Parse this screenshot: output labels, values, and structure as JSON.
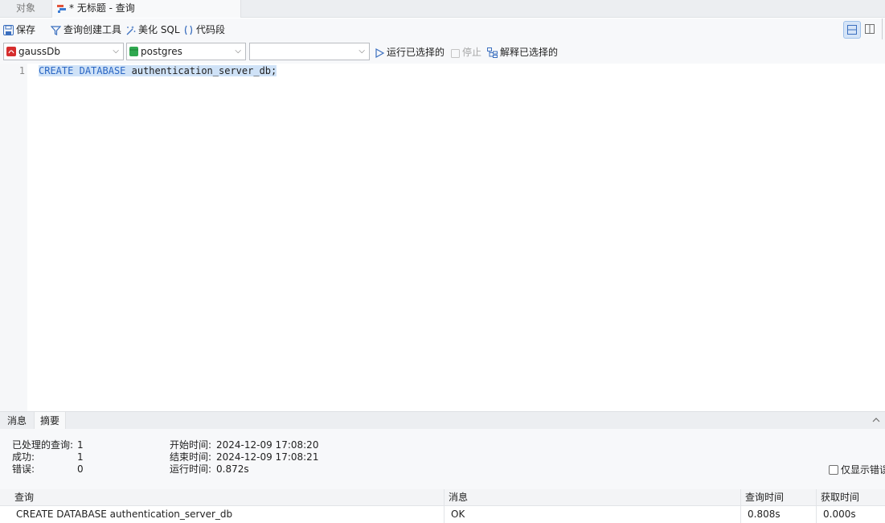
{
  "tabs": {
    "objects": "对象",
    "query": "* 无标题 - 查询"
  },
  "toolbar": {
    "save": "保存",
    "query_builder": "查询创建工具",
    "beautify": "美化 SQL",
    "snippet": "代码段"
  },
  "selectors": {
    "connection": "gaussDb",
    "database": "postgres",
    "schema": ""
  },
  "actions": {
    "run_selected": "运行已选择的",
    "stop": "停止",
    "explain_selected": "解释已选择的"
  },
  "editor": {
    "line_number": "1",
    "kw1": "CREATE",
    "kw2": "DATABASE",
    "identifier": "authentication_server_db;"
  },
  "panel_tabs": {
    "messages": "消息",
    "summary": "摘要"
  },
  "summary": {
    "processed_label": "已处理的查询:",
    "processed_value": "1",
    "success_label": "成功:",
    "success_value": "1",
    "errors_label": "错误:",
    "errors_value": "0",
    "start_label": "开始时间:",
    "start_value": "2024-12-09 17:08:20",
    "end_label": "结束时间:",
    "end_value": "2024-12-09 17:08:21",
    "elapsed_label": "运行时间:",
    "elapsed_value": "0.872s",
    "only_errors": "仅显示错误"
  },
  "results": {
    "columns": [
      "查询",
      "消息",
      "查询时间",
      "获取时间"
    ],
    "rows": [
      [
        "CREATE DATABASE authentication_server_db",
        "OK",
        "0.808s",
        "0.000s"
      ]
    ]
  },
  "colors": {
    "accent": "#2a66c4",
    "selection": "#cfe2f7"
  }
}
